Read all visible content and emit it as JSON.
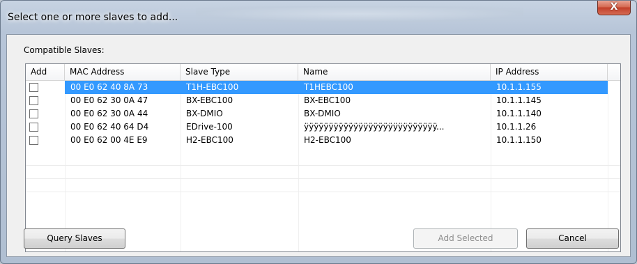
{
  "window": {
    "title": "Select one or more slaves to add...",
    "close_glyph": "X"
  },
  "section_label": "Compatible Slaves:",
  "columns": [
    "Add",
    "MAC Address",
    "Slave Type",
    "Name",
    "IP Address"
  ],
  "rows": [
    {
      "checked": false,
      "mac": "00 E0 62 40 8A 73",
      "type": "T1H-EBC100",
      "name": "T1HEBC100",
      "ip": "10.1.1.155",
      "selected": true
    },
    {
      "checked": false,
      "mac": "00 E0 62 30 0A 47",
      "type": "BX-EBC100",
      "name": "BX-EBC100",
      "ip": "10.1.1.145",
      "selected": false
    },
    {
      "checked": false,
      "mac": "00 E0 62 30 0A 44",
      "type": "BX-DMIO",
      "name": "BX-DMIO",
      "ip": "10.1.1.140",
      "selected": false
    },
    {
      "checked": false,
      "mac": "00 E0 62 40 64 D4",
      "type": "EDrive-100",
      "name": "ÿÿÿÿÿÿÿÿÿÿÿÿÿÿÿÿÿÿÿÿÿÿÿÿÿÿÿ...",
      "ip": "10.1.1.26",
      "selected": false
    },
    {
      "checked": false,
      "mac": "00 E0 62 00 4E E9",
      "type": "H2-EBC100",
      "name": "H2-EBC100",
      "ip": "10.1.1.150",
      "selected": false
    }
  ],
  "buttons": {
    "query": "Query Slaves",
    "add_selected": "Add Selected",
    "cancel": "Cancel"
  },
  "colors": {
    "selection": "#3399ff",
    "close_button": "#c2402a"
  }
}
